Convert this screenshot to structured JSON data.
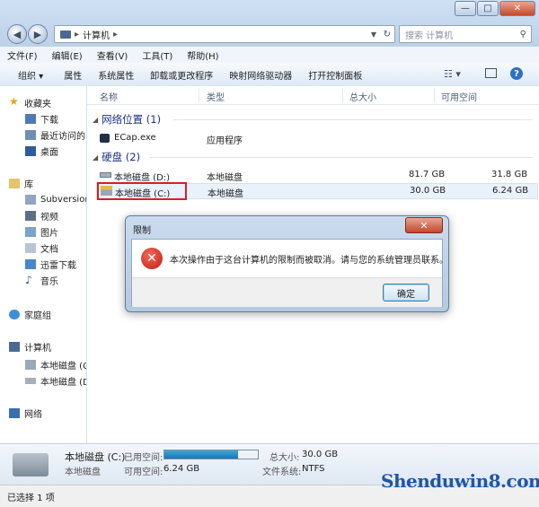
{
  "window": {
    "controls": [
      "—",
      "□",
      "✕"
    ]
  },
  "address": {
    "path": "计算机",
    "search_placeholder": "搜索 计算机"
  },
  "menu": [
    "文件(F)",
    "编辑(E)",
    "查看(V)",
    "工具(T)",
    "帮助(H)"
  ],
  "toolbar": {
    "organize": "组织 ▾",
    "properties": "属性",
    "system_properties": "系统属性",
    "uninstall": "卸载或更改程序",
    "map_drive": "映射网络驱动器",
    "control_panel": "打开控制面板"
  },
  "sidebar": {
    "favorites": "收藏夹",
    "downloads": "下载",
    "recent": "最近访问的",
    "desktop": "桌面",
    "libraries": "库",
    "subversion": "Subversion",
    "videos": "视频",
    "pictures": "图片",
    "documents": "文档",
    "xunlei": "迅雷下载",
    "music": "音乐",
    "homegroup": "家庭组",
    "computer": "计算机",
    "drive_c": "本地磁盘 (C",
    "drive_d": "本地磁盘 (D",
    "network": "网络"
  },
  "columns": {
    "name": "名称",
    "type": "类型",
    "total": "总大小",
    "free": "可用空间"
  },
  "groups": {
    "network_locations": "网络位置 (1)",
    "hard_drives": "硬盘 (2)"
  },
  "items": {
    "ecap": {
      "name": "ECap.exe",
      "type": "应用程序"
    },
    "drive_d": {
      "name": "本地磁盘 (D:)",
      "type": "本地磁盘",
      "total": "81.7 GB",
      "free": "31.8 GB"
    },
    "drive_c": {
      "name": "本地磁盘 (C:)",
      "type": "本地磁盘",
      "total": "30.0 GB",
      "free": "6.24 GB"
    }
  },
  "details": {
    "name": "本地磁盘 (C:)",
    "kind": "本地磁盘",
    "used_label": "已用空间:",
    "free_label": "可用空间:",
    "free_value": "6.24 GB",
    "total_label": "总大小:",
    "total_value": "30.0 GB",
    "fs_label": "文件系统:",
    "fs_value": "NTFS",
    "used_fraction": 0.79
  },
  "status": {
    "selected": "已选择 1 项"
  },
  "dialog": {
    "title": "限制",
    "message": "本次操作由于这台计算机的限制而被取消。请与您的系统管理员联系。",
    "ok": "确定"
  },
  "watermark": "Shenduwin8.com",
  "colors": {
    "accent": "#1e3287",
    "error_red": "#d62020",
    "watermark": "#1e57a8"
  }
}
